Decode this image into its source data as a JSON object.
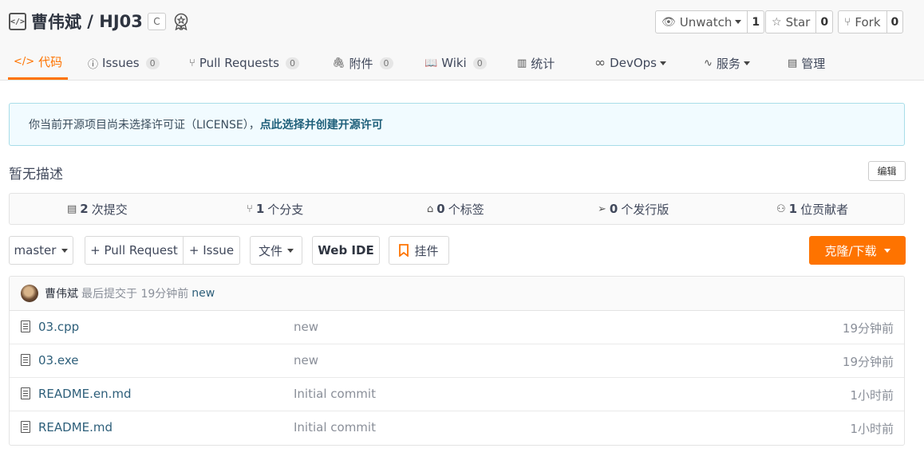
{
  "repo": {
    "owner": "曹伟斌",
    "separator": " / ",
    "name": "HJ03",
    "language_badge": "C"
  },
  "social": {
    "watch": {
      "label": "Unwatch",
      "count": "1"
    },
    "star": {
      "label": "Star",
      "count": "0"
    },
    "fork": {
      "label": "Fork",
      "count": "0"
    }
  },
  "tabs": [
    {
      "label": "代码",
      "icon": "code-icon",
      "count": null
    },
    {
      "label": "Issues",
      "icon": "issue-icon",
      "count": "0"
    },
    {
      "label": "Pull Requests",
      "icon": "pull-request-icon",
      "count": "0"
    },
    {
      "label": "附件",
      "icon": "attachment-icon",
      "count": "0"
    },
    {
      "label": "Wiki",
      "icon": "wiki-icon",
      "count": "0"
    },
    {
      "label": "统计",
      "icon": "stats-icon",
      "count": null
    },
    {
      "label": "DevOps",
      "icon": "infinity-icon",
      "count": null
    },
    {
      "label": "服务",
      "icon": "pulse-icon",
      "count": null
    },
    {
      "label": "管理",
      "icon": "manage-icon",
      "count": null
    }
  ],
  "license": {
    "text": "你当前开源项目尚未选择许可证（LICENSE），",
    "link": "点此选择并创建开源许可"
  },
  "description": "暂无描述",
  "edit_label": "编辑",
  "stats": {
    "commits": {
      "count": "2",
      "label": "次提交"
    },
    "branches": {
      "count": "1",
      "label": "个分支"
    },
    "tags": {
      "count": "0",
      "label": "个标签"
    },
    "releases": {
      "count": "0",
      "label": "个发行版"
    },
    "contributors": {
      "count": "1",
      "label": "位贡献者"
    }
  },
  "toolbar": {
    "branch": "master",
    "pull_request": "+ Pull Request",
    "issue": "+ Issue",
    "file": "文件",
    "web_ide": "Web IDE",
    "widget": "挂件",
    "clone": "克隆/下载"
  },
  "commit": {
    "author": "曹伟斌",
    "meta": "最后提交于 19分钟前",
    "message": "new"
  },
  "files": [
    {
      "name": "03.cpp",
      "message": "new",
      "time": "19分钟前"
    },
    {
      "name": "03.exe",
      "message": "new",
      "time": "19分钟前"
    },
    {
      "name": "README.en.md",
      "message": "Initial commit",
      "time": "1小时前"
    },
    {
      "name": "README.md",
      "message": "Initial commit",
      "time": "1小时前"
    }
  ],
  "colors": {
    "accent": "#fe7300",
    "link": "#2e5f7a"
  }
}
